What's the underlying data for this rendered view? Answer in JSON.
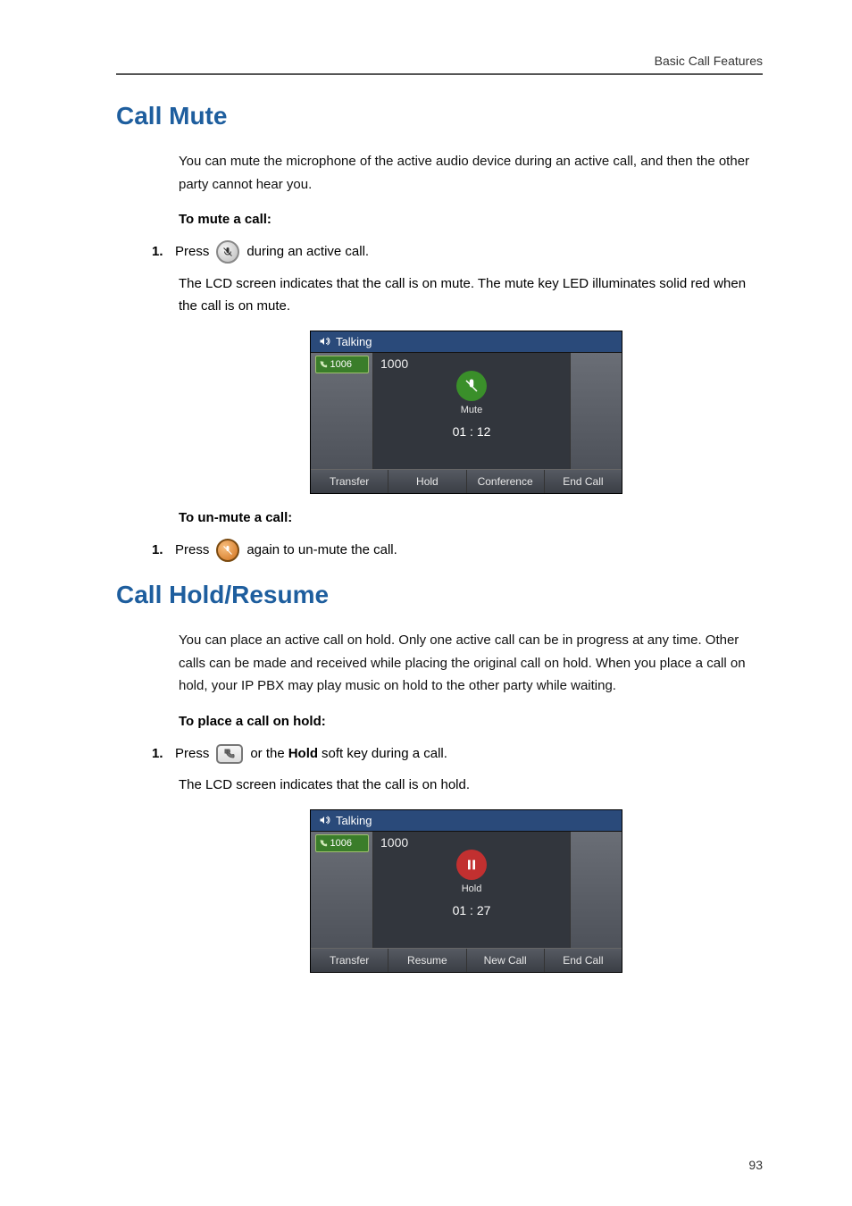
{
  "running_head": "Basic Call Features",
  "page_number": "93",
  "mute": {
    "heading": "Call Mute",
    "intro": "You can mute the microphone of the active audio device during an active call, and then the other party cannot hear you.",
    "to_mute_label": "To mute a call:",
    "step1_num": "1.",
    "step1_a": "Press",
    "step1_b": "during an active call.",
    "result": "The LCD screen indicates that the call is on mute. The mute key LED illuminates solid red when the call is on mute.",
    "to_unmute_label": "To un-mute a call:",
    "un_step1_num": "1.",
    "un_step1_a": "Press",
    "un_step1_b": "again to un-mute the call."
  },
  "hold": {
    "heading": "Call Hold/Resume",
    "intro": "You can place an active call on hold. Only one active call can be in progress at any time. Other calls can be made and received while placing the original call on hold. When you place a call on hold, your IP PBX may play music on hold to the other party while waiting.",
    "to_hold_label": "To place a call on hold:",
    "step1_num": "1.",
    "step1_a": "Press",
    "step1_b": "or the",
    "step1_bold": "Hold",
    "step1_c": "soft key during a call.",
    "result": "The LCD screen indicates that the call is on hold."
  },
  "screens": {
    "mute": {
      "title": "Talking",
      "account": "1006",
      "remote": "1000",
      "status": "Mute",
      "timer": "01 : 12",
      "softkeys": [
        "Transfer",
        "Hold",
        "Conference",
        "End Call"
      ]
    },
    "hold": {
      "title": "Talking",
      "account": "1006",
      "remote": "1000",
      "status": "Hold",
      "timer": "01 : 27",
      "softkeys": [
        "Transfer",
        "Resume",
        "New Call",
        "End Call"
      ]
    }
  }
}
